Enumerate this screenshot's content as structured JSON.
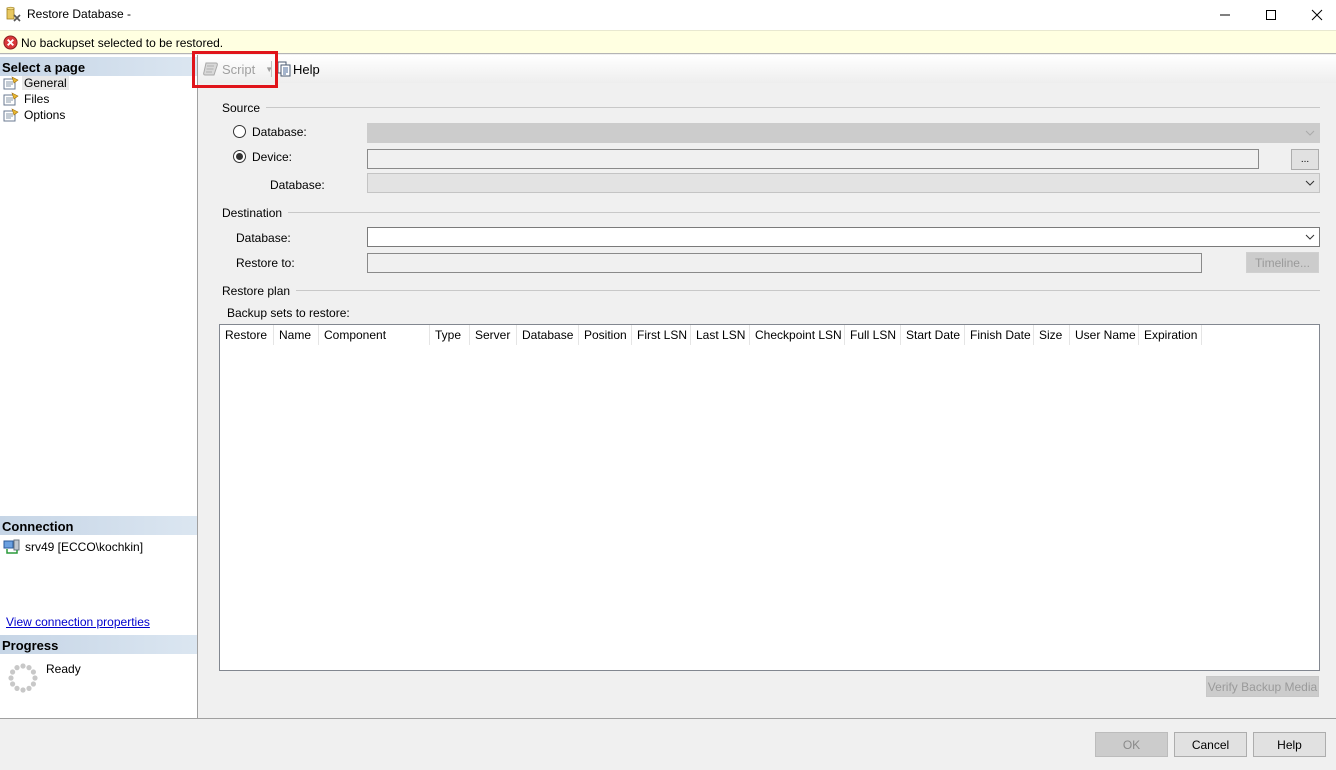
{
  "window": {
    "title": "Restore Database -",
    "controls": {
      "minimize": "minimize",
      "maximize": "maximize",
      "close": "close"
    }
  },
  "message_bar": {
    "icon": "error-icon",
    "text": "No backupset selected to be restored."
  },
  "sidebar": {
    "select_page_header": "Select a page",
    "pages": [
      {
        "label": "General",
        "selected": true
      },
      {
        "label": "Files",
        "selected": false
      },
      {
        "label": "Options",
        "selected": false
      }
    ],
    "connection_header": "Connection",
    "connection": "srv49 [ECCO\\kochkin]",
    "connection_link": "View connection properties",
    "progress_header": "Progress",
    "progress_status": "Ready"
  },
  "toolbar": {
    "script_label": "Script",
    "help_label": "Help"
  },
  "source": {
    "group_label": "Source",
    "database_radio_label": "Database:",
    "device_radio_label": "Device:",
    "selected_option": "Device",
    "database_combo_value": "",
    "device_value": "",
    "browse_button": "...",
    "device_database_label": "Database:",
    "device_database_value": ""
  },
  "destination": {
    "group_label": "Destination",
    "database_label": "Database:",
    "database_value": "",
    "restore_to_label": "Restore to:",
    "restore_to_value": "",
    "timeline_button": "Timeline..."
  },
  "restore_plan": {
    "group_label": "Restore plan",
    "backup_sets_label": "Backup sets to restore:",
    "columns": [
      "Restore",
      "Name",
      "Component",
      "Type",
      "Server",
      "Database",
      "Position",
      "First LSN",
      "Last LSN",
      "Checkpoint LSN",
      "Full LSN",
      "Start Date",
      "Finish Date",
      "Size",
      "User Name",
      "Expiration"
    ],
    "rows": [],
    "verify_button": "Verify Backup Media"
  },
  "footer": {
    "ok": "OK",
    "cancel": "Cancel",
    "help": "Help"
  }
}
